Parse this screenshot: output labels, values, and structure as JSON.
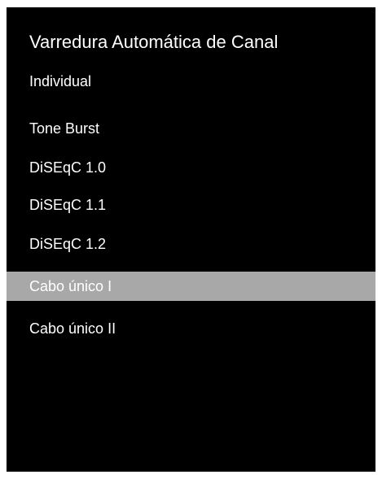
{
  "dialog": {
    "title": "Varredura Automática de Canal",
    "subtitle": "Individual"
  },
  "menu": {
    "items": [
      {
        "label": "Tone Burst",
        "selected": false
      },
      {
        "label": "DiSEqC 1.0",
        "selected": false
      },
      {
        "label": "DiSEqC 1.1",
        "selected": false
      },
      {
        "label": "DiSEqC 1.2",
        "selected": false
      },
      {
        "label": "Cabo único I",
        "selected": true
      },
      {
        "label": "Cabo único II",
        "selected": false
      }
    ]
  },
  "colors": {
    "background": "#000000",
    "text": "#ffffff",
    "highlight": "#a8a8a8",
    "frame": "#ffffff"
  }
}
